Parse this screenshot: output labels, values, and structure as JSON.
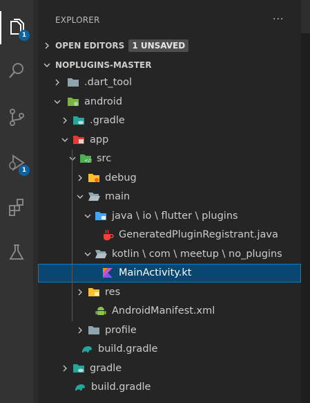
{
  "activity_bar": {
    "explorer_badge": "1",
    "debug_badge": "1"
  },
  "explorer": {
    "title": "EXPLORER",
    "more": "···",
    "open_editors": {
      "label": "OPEN EDITORS",
      "badge": "1 UNSAVED"
    },
    "project": "NOPLUGINS-MASTER"
  },
  "tree": [
    {
      "label": ".dart_tool",
      "chevron": "right",
      "icon": "folder-grey-icon"
    },
    {
      "label": "android",
      "chevron": "down",
      "icon": "folder-android-icon"
    },
    {
      "label": ".gradle",
      "chevron": "right",
      "icon": "folder-gradle-icon"
    },
    {
      "label": "app",
      "chevron": "down",
      "icon": "folder-app-icon"
    },
    {
      "label": "src",
      "chevron": "down",
      "icon": "folder-src-icon"
    },
    {
      "label": "debug",
      "chevron": "right",
      "icon": "folder-debug-icon"
    },
    {
      "label": "main",
      "chevron": "down",
      "icon": "folder-open-icon"
    },
    {
      "label": "java \\ io \\ flutter \\ plugins",
      "chevron": "down",
      "icon": "folder-java-icon"
    },
    {
      "label": "GeneratedPluginRegistrant.java",
      "chevron": "none",
      "icon": "java-file-icon"
    },
    {
      "label": "kotlin \\ com \\ meetup \\ no_plugins",
      "chevron": "down",
      "icon": "folder-open-icon"
    },
    {
      "label": "MainActivity.kt",
      "chevron": "none",
      "icon": "kotlin-file-icon",
      "selected": true
    },
    {
      "label": "res",
      "chevron": "right",
      "icon": "folder-res-icon"
    },
    {
      "label": "AndroidManifest.xml",
      "chevron": "none",
      "icon": "android-file-icon"
    },
    {
      "label": "profile",
      "chevron": "right",
      "icon": "folder-grey-icon"
    },
    {
      "label": "build.gradle",
      "chevron": "none",
      "icon": "gradle-file-icon"
    },
    {
      "label": "gradle",
      "chevron": "right",
      "icon": "folder-gradle-icon"
    },
    {
      "label": "build.gradle",
      "chevron": "none",
      "icon": "gradle-file-icon"
    }
  ],
  "colors": {
    "activity_bar": "#333333",
    "sidebar": "#252526",
    "selection": "#094771",
    "badge": "#0e639c"
  }
}
